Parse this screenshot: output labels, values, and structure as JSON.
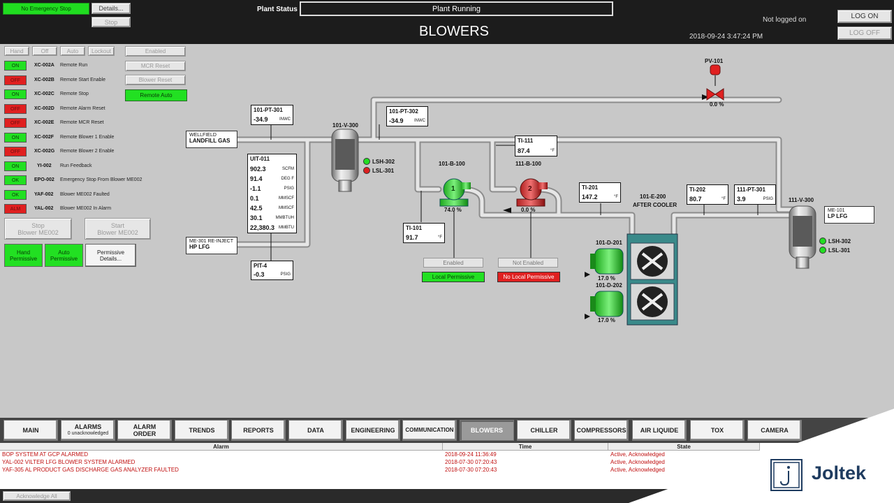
{
  "header": {
    "emergency_status": "No Emergency Stop",
    "details_btn": "Details...",
    "stop_btn": "Stop",
    "plant_status_label": "Plant Status",
    "plant_status_value": "Plant Running",
    "title": "BLOWERS",
    "login_status": "Not logged on",
    "timestamp": "2018-09-24 3:47:24 PM",
    "log_on": "LOG ON",
    "log_off": "LOG OFF"
  },
  "mode_buttons": [
    "Hand",
    "Off",
    "Auto",
    "Lockout"
  ],
  "right_buttons": {
    "enabled": "Enabled",
    "mcr_reset": "MCR Reset",
    "blower_reset": "Blower Reset",
    "remote_auto": "Remote Auto"
  },
  "indicators": [
    {
      "state": "ON",
      "tag": "XC-002A",
      "desc": "Remote Run"
    },
    {
      "state": "OFF",
      "tag": "XC-002B",
      "desc": "Remote Start Enable"
    },
    {
      "state": "ON",
      "tag": "XC-002C",
      "desc": "Remote Stop"
    },
    {
      "state": "OFF",
      "tag": "XC-002D",
      "desc": "Remote Alarm Reset"
    },
    {
      "state": "OFF",
      "tag": "XC-002E",
      "desc": "Remote MCR Reset"
    },
    {
      "state": "ON",
      "tag": "XC-002F",
      "desc": "Remote Blower 1 Enable"
    },
    {
      "state": "OFF",
      "tag": "XC-002G",
      "desc": "Remote Blower 2 Enable"
    },
    {
      "state": "ON",
      "tag": "YI-002",
      "desc": "Run Feedback"
    },
    {
      "state": "OK",
      "tag": "EPO-002",
      "desc": "Emergency Stop From Blower ME002"
    },
    {
      "state": "OK",
      "tag": "YAF-002",
      "desc": "Blower ME002 Faulted"
    },
    {
      "state": "ALM",
      "tag": "YAL-002",
      "desc": "Blower ME002 In Alarm"
    }
  ],
  "blower_cmds": {
    "stop_line1": "Stop",
    "stop_line2": "Blower ME002",
    "start_line1": "Start",
    "start_line2": "Blower ME002"
  },
  "permissives": {
    "hand_l1": "Hand",
    "hand_l2": "Permissive",
    "auto_l1": "Auto",
    "auto_l2": "Permissive",
    "details_l1": "Permissive",
    "details_l2": "Details..."
  },
  "process": {
    "wellfield_l1": "WELLFIELD",
    "wellfield_l2": "LANDFILL GAS",
    "me301_l1": "ME-301 RE-INJECT",
    "me301_l2": "HP LFG",
    "me101_l1": "ME-101",
    "me101_l2": "LP LFG",
    "pt301": {
      "tag": "101-PT-301",
      "value": "-34.9",
      "unit": "INWC"
    },
    "pt302": {
      "tag": "101-PT-302",
      "value": "-34.9",
      "unit": "INWC"
    },
    "uit": {
      "tag": "UIT-011",
      "rows": [
        {
          "value": "902.3",
          "unit": "SCFM"
        },
        {
          "value": "91.4",
          "unit": "DEG F"
        },
        {
          "value": "-1.1",
          "unit": "PSIG"
        },
        {
          "value": "0.1",
          "unit": "MMSCF"
        },
        {
          "value": "42.5",
          "unit": "MMSCF"
        },
        {
          "value": "30.1",
          "unit": "MMBTUH"
        },
        {
          "value": "22,380.3",
          "unit": "MMBTU"
        }
      ]
    },
    "pit4": {
      "tag": "PIT-4",
      "value": "-0.3",
      "unit": "PSIG"
    },
    "ti111": {
      "tag": "TI-111",
      "value": "87.4",
      "unit": "°F"
    },
    "ti101": {
      "tag": "TI-101",
      "value": "91.7",
      "unit": "°F"
    },
    "ti201": {
      "tag": "TI-201",
      "value": "147.2",
      "unit": "°F"
    },
    "ti202": {
      "tag": "TI-202",
      "value": "80.7",
      "unit": "°F"
    },
    "pt111": {
      "tag": "111-PT-301",
      "value": "3.9",
      "unit": "PSIG"
    },
    "v300_label": "101-V-300",
    "v111_label": "111-V-300",
    "lsh302": "LSH-302",
    "lsl301": "LSL-301",
    "b100_label": "101-B-100",
    "b111_label": "111-B-100",
    "blower1_num": "1",
    "blower2_num": "2",
    "blower1_pct": "74.0 %",
    "blower2_pct": "0.0 %",
    "pv101_label": "PV-101",
    "pv101_pct": "0.0 %",
    "cooler_l1": "101-E-200",
    "cooler_l2": "AFTER COOLER",
    "fan1_label": "101-D-201",
    "fan2_label": "101-D-202",
    "fan1_pct": "17.0 %",
    "fan2_pct": "17.0 %",
    "b1_enabled": "Enabled",
    "b1_local": "Local Permissive",
    "b2_enabled": "Not Enabled",
    "b2_local": "No Local Permissive"
  },
  "nav": [
    {
      "label": "MAIN"
    },
    {
      "label": "ALARMS",
      "sub": "0 unacknowledged"
    },
    {
      "label": "ALARM",
      "sub": "ORDER"
    },
    {
      "label": "TRENDS"
    },
    {
      "label": "REPORTS"
    },
    {
      "label": "DATA"
    },
    {
      "label": "ENGINEERING"
    },
    {
      "label": "COMMUNICATION"
    },
    {
      "label": "BLOWERS"
    },
    {
      "label": "CHILLER"
    },
    {
      "label": "COMPRESSORS"
    },
    {
      "label": "AIR LIQUIDE"
    },
    {
      "label": "TOX"
    },
    {
      "label": "CAMERA"
    }
  ],
  "alarm_table": {
    "headers": [
      "Alarm",
      "Time",
      "State"
    ],
    "rows": [
      {
        "alarm": "BOP SYSTEM AT GCP ALARMED",
        "time": "2018-09-24 11:36:49",
        "state": "Active, Acknowledged"
      },
      {
        "alarm": "YAL-002 VILTER LFG BLOWER SYSTEM ALARMED",
        "time": "2018-07-30 07:20:43",
        "state": "Active, Acknowledged"
      },
      {
        "alarm": "YAF-305 AL PRODUCT GAS DISCHARGE GAS ANALYZER FAULTED",
        "time": "2018-07-30 07:20:43",
        "state": "Active, Acknowledged"
      }
    ],
    "ack_all": "Acknowledge All"
  },
  "brand": "Joltek",
  "colors": {
    "on": "#22e022",
    "off": "#e02020",
    "pipe": "#bdbdbd",
    "navy": "#1f3c60"
  }
}
